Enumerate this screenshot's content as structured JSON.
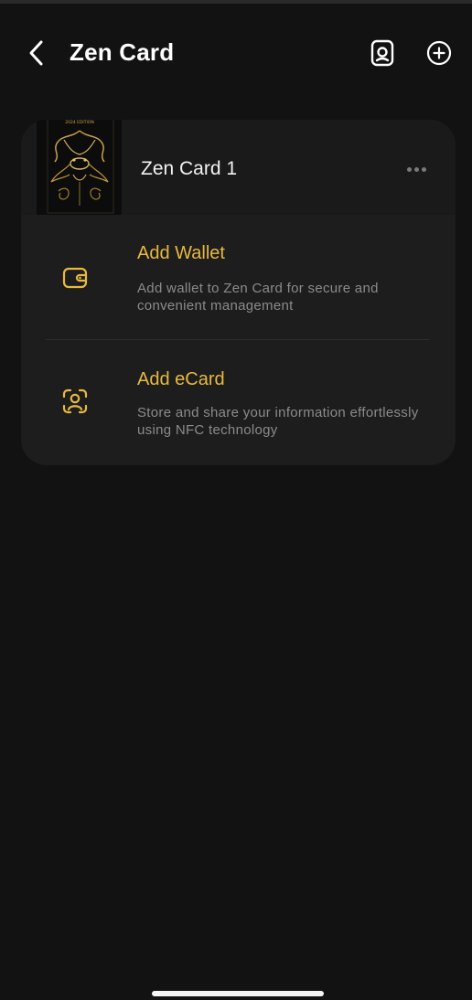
{
  "header": {
    "title": "Zen Card",
    "back_icon": "chevron-left-icon",
    "scan_icon": "card-scan-icon",
    "add_icon": "plus-circle-icon"
  },
  "card": {
    "name": "Zen Card 1",
    "thumbnail_caption": "2024 EDITION",
    "more_icon": "more-horizontal-icon"
  },
  "actions": [
    {
      "title": "Add Wallet",
      "description": "Add wallet to Zen Card for secure and convenient management",
      "icon": "wallet-icon"
    },
    {
      "title": "Add eCard",
      "description": "Store and share your information effortlessly using NFC technology",
      "icon": "id-scan-icon"
    }
  ],
  "colors": {
    "background": "#121212",
    "card_bg": "#1d1d1d",
    "accent": "#e7b93e",
    "text_primary": "#ffffff",
    "text_secondary": "#8b8b8b"
  }
}
